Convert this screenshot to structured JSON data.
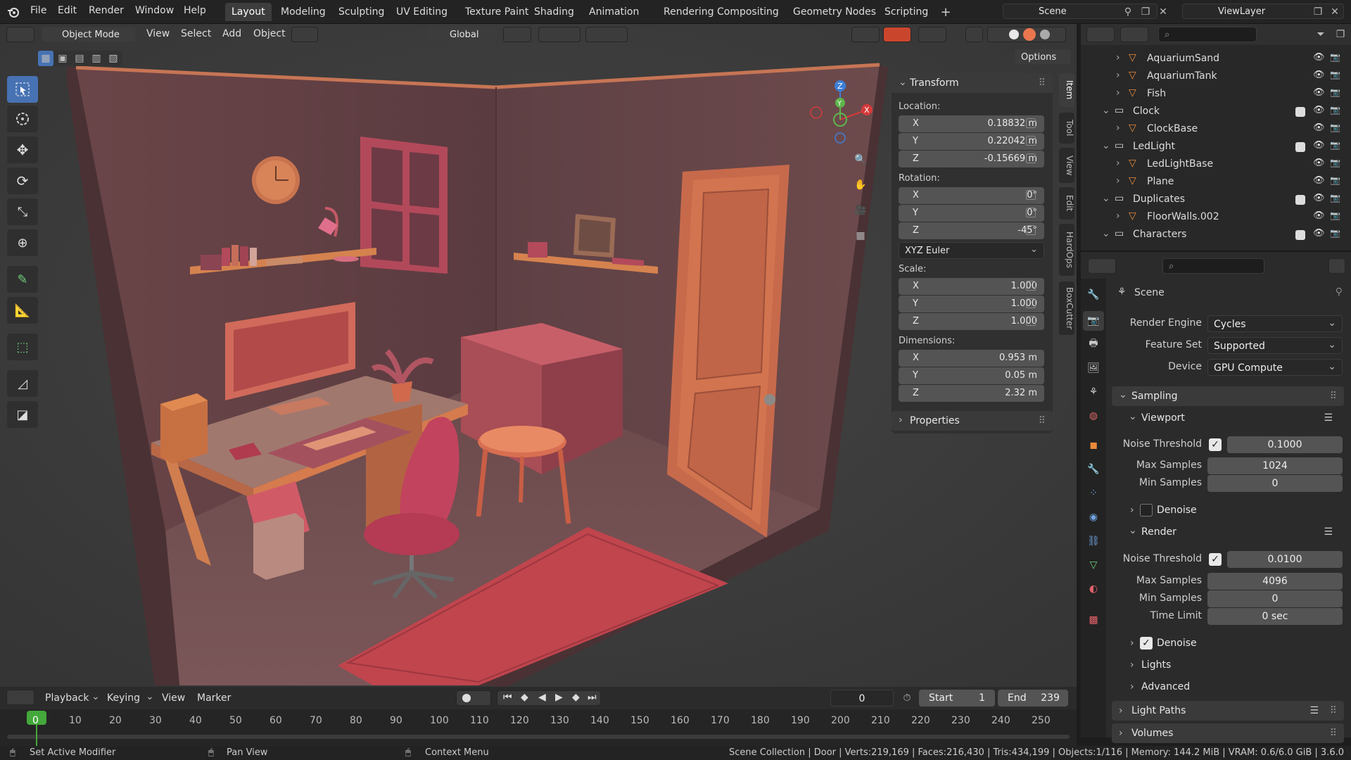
{
  "menu": {
    "file": "File",
    "edit": "Edit",
    "render": "Render",
    "window": "Window",
    "help": "Help"
  },
  "workspaces": [
    "Layout",
    "Modeling",
    "Sculpting",
    "UV Editing",
    "Texture Paint",
    "Shading",
    "Animation",
    "Rendering",
    "Compositing",
    "Geometry Nodes",
    "Scripting"
  ],
  "active_workspace": "Layout",
  "scene_name": "Scene",
  "view_layer": "ViewLayer",
  "viewport_header": {
    "mode": "Object Mode",
    "view": "View",
    "select": "Select",
    "add": "Add",
    "object": "Object",
    "orientation": "Global",
    "options": "Options"
  },
  "npanel": {
    "transform": "Transform",
    "location_label": "Location:",
    "location": {
      "x": "0.18832 m",
      "y": "0.22042 m",
      "z": "-0.15669 m"
    },
    "rotation_label": "Rotation:",
    "rotation": {
      "x": "0°",
      "y": "0°",
      "z": "-45°"
    },
    "rotation_mode": "XYZ Euler",
    "scale_label": "Scale:",
    "scale": {
      "x": "1.000",
      "y": "1.000",
      "z": "1.000"
    },
    "dimensions_label": "Dimensions:",
    "dimensions": {
      "x": "0.953 m",
      "y": "0.05 m",
      "z": "2.32 m"
    },
    "properties": "Properties",
    "axes": {
      "x": "X",
      "y": "Y",
      "z": "Z"
    }
  },
  "side_tabs": [
    "Item",
    "Tool",
    "View",
    "Edit",
    "HardOps",
    "BoxCutter"
  ],
  "outliner": {
    "rows": [
      {
        "name": "AquariumSand",
        "kind": "mesh",
        "indent": 2
      },
      {
        "name": "AquariumTank",
        "kind": "mesh",
        "indent": 2
      },
      {
        "name": "Fish",
        "kind": "mesh",
        "indent": 2
      },
      {
        "name": "Clock",
        "kind": "collection",
        "indent": 1
      },
      {
        "name": "ClockBase",
        "kind": "mesh",
        "indent": 2
      },
      {
        "name": "LedLight",
        "kind": "collection",
        "indent": 1
      },
      {
        "name": "LedLightBase",
        "kind": "mesh",
        "indent": 2
      },
      {
        "name": "Plane",
        "kind": "mesh",
        "indent": 2
      },
      {
        "name": "Duplicates",
        "kind": "collection",
        "indent": 1
      },
      {
        "name": "FloorWalls.002",
        "kind": "mesh",
        "indent": 2
      },
      {
        "name": "Characters",
        "kind": "collection",
        "indent": 1
      }
    ]
  },
  "properties": {
    "context": "Scene",
    "render_engine_label": "Render Engine",
    "render_engine": "Cycles",
    "feature_set_label": "Feature Set",
    "feature_set": "Supported",
    "device_label": "Device",
    "device": "GPU Compute",
    "sampling": "Sampling",
    "viewport": "Viewport",
    "vp_noise_label": "Noise Threshold",
    "vp_noise": "0.1000",
    "vp_max_label": "Max Samples",
    "vp_max": "1024",
    "vp_min_label": "Min Samples",
    "vp_min": "0",
    "vp_denoise": "Denoise",
    "render": "Render",
    "r_noise_label": "Noise Threshold",
    "r_noise": "0.0100",
    "r_max_label": "Max Samples",
    "r_max": "4096",
    "r_min_label": "Min Samples",
    "r_min": "0",
    "r_time_label": "Time Limit",
    "r_time": "0 sec",
    "r_denoise": "Denoise",
    "lights": "Lights",
    "advanced": "Advanced",
    "light_paths": "Light Paths",
    "volumes": "Volumes"
  },
  "timeline": {
    "playback": "Playback",
    "keying": "Keying",
    "view": "View",
    "marker": "Marker",
    "current_frame": "0",
    "start_label": "Start",
    "start": "1",
    "end_label": "End",
    "end": "239",
    "ticks": [
      "0",
      "10",
      "20",
      "30",
      "40",
      "50",
      "60",
      "70",
      "80",
      "90",
      "100",
      "110",
      "120",
      "130",
      "140",
      "150",
      "160",
      "170",
      "180",
      "190",
      "200",
      "210",
      "220",
      "230",
      "240",
      "250"
    ]
  },
  "status": {
    "left1": "Set Active Modifier",
    "left2": "Pan View",
    "left3": "Context Menu",
    "right": "Scene Collection | Door | Verts:219,169 | Faces:216,430 | Tris:434,199 | Objects:1/116 | Memory: 144.2 MiB | VRAM: 0.6/6.0 GiB | 3.6.0"
  },
  "colors": {
    "accent": "#4772b3",
    "active_frame": "#44a83a",
    "selection": "#e8893a"
  }
}
